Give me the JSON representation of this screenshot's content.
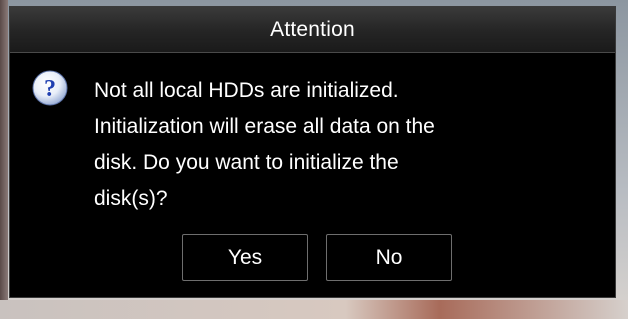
{
  "dialog": {
    "title": "Attention",
    "icon": "question-icon",
    "message_lines": [
      "Not all local HDDs are initialized.",
      "Initialization will erase all data on the",
      "disk. Do you want to initialize the",
      "disk(s)?"
    ],
    "buttons": {
      "yes_label": "Yes",
      "no_label": "No"
    }
  },
  "colors": {
    "dialog_background": "#000000",
    "title_text": "#ffffff",
    "icon_fill": "#1f3fb0"
  }
}
